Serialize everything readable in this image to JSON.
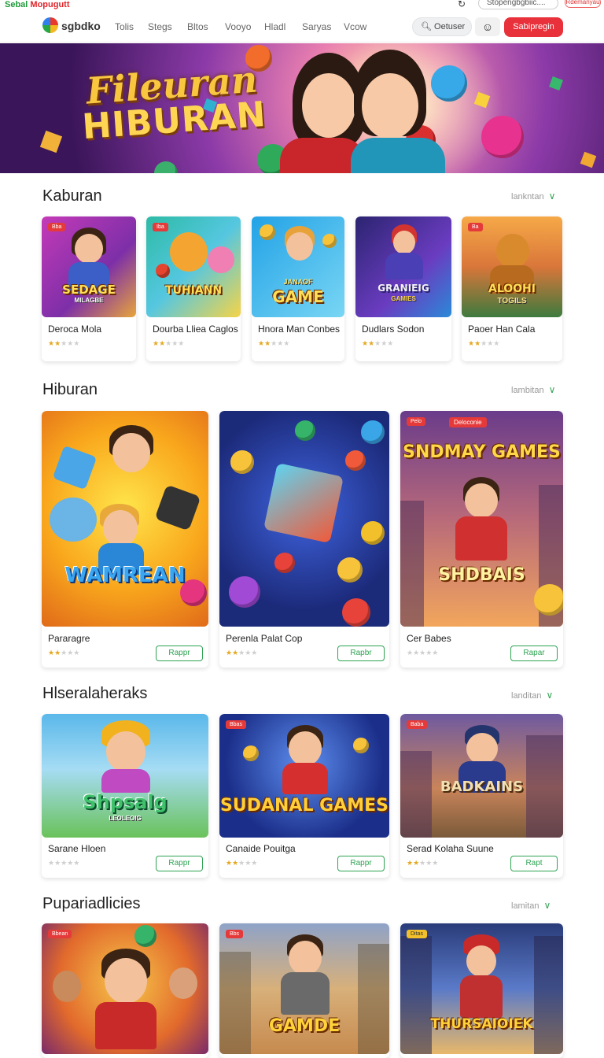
{
  "topstrip": {
    "brand_green": "Sebal",
    "brand_red": "Mopugutt",
    "search_text": "Stopengbgbiic....",
    "pill_text": "Rdemanyau"
  },
  "nav": {
    "logo_text": "sgbdko",
    "links": [
      "Tolis",
      "Stegs",
      "Bltos",
      "Vooyo",
      "Hladl",
      "Saryas",
      "Vcow"
    ],
    "search_placeholder": "Oetuser",
    "cta_label": "Sabipregin"
  },
  "hero": {
    "title_line1": "Fileuran",
    "title_line2": "HIBURAN"
  },
  "sections": [
    {
      "title": "Kaburan",
      "more": "lankntan",
      "cards": [
        {
          "name": "Deroca Mola",
          "rating": 2,
          "badge": "Bba",
          "art_title": "SEDAGE",
          "art_sub": "MILAGBE",
          "colors": [
            "#b13ac0",
            "#e7a73b"
          ]
        },
        {
          "name": "Dourba Lliea Caglos",
          "rating": 2,
          "badge": "Iba",
          "art_title": "TUHIANN",
          "art_sub": "",
          "colors": [
            "#3dbfa4",
            "#f3d34a"
          ]
        },
        {
          "name": "Hnora Man Conbes",
          "rating": 2,
          "badge": "",
          "art_title": "GAME",
          "art_sub": "JANAOF",
          "colors": [
            "#2ea6e8",
            "#7fd6f5"
          ]
        },
        {
          "name": "Dudlars Sodon",
          "rating": 2,
          "badge": "",
          "art_title": "GRANIEIG",
          "art_sub": "GAMIES",
          "colors": [
            "#3a2a8c",
            "#8c4ad2"
          ]
        },
        {
          "name": "Paoer Han Cala",
          "rating": 2,
          "badge": "Ba",
          "art_title": "ALOOHI",
          "art_sub": "TOGILS",
          "colors": [
            "#f09a3a",
            "#4b8a4a"
          ]
        }
      ]
    },
    {
      "title": "Hiburan",
      "more": "lambitan",
      "cards": [
        {
          "name": "Pararagre",
          "rating": 2,
          "play": "Rappr",
          "badge": "",
          "art_title": "WAMREAN",
          "art_sub": "",
          "colors": [
            "#f7a71e",
            "#ffdf4d"
          ]
        },
        {
          "name": "Perenla Palat Cop",
          "rating": 2,
          "play": "Rapbr",
          "badge": "",
          "art_title": "",
          "art_sub": "",
          "colors": [
            "#1d2a7c",
            "#3f5ad6"
          ]
        },
        {
          "name": "Cer Babes",
          "rating": 0,
          "play": "Rapar",
          "badge": "Pelo",
          "badge2": "Deloconie",
          "art_title": "SNDMAY GAMES",
          "art_sub": "SHDBAIS",
          "colors": [
            "#7a3c8a",
            "#f4b062"
          ]
        }
      ]
    },
    {
      "title": "Hlseralaheraks",
      "more": "landitan",
      "cards": [
        {
          "name": "Sarane Hloen",
          "rating": 0,
          "play": "Rappr",
          "badge": "",
          "art_title": "Shpsalg",
          "art_sub": "LEOLEOIG",
          "colors": [
            "#3aa0e0",
            "#8fd36a"
          ]
        },
        {
          "name": "Canaide Pouitga",
          "rating": 2,
          "play": "Rappr",
          "badge": "Bbas",
          "art_title": "SUDANAL GAMES",
          "art_sub": "",
          "colors": [
            "#1e3b9c",
            "#4778e6"
          ]
        },
        {
          "name": "Serad Kolaha Suune",
          "rating": 2,
          "play": "Rapt",
          "badge": "Baba",
          "art_title": "BADKAINS",
          "art_sub": "",
          "colors": [
            "#5a3f7e",
            "#e8a35a"
          ]
        }
      ]
    },
    {
      "title": "Pupariadlicies",
      "more": "lamitan",
      "cards": [
        {
          "name": "",
          "badge": "Bbean",
          "art_title": "",
          "colors": [
            "#e26a2c",
            "#f5c04a"
          ]
        },
        {
          "name": "",
          "badge": "Bbs",
          "art_title": "GAMDE",
          "colors": [
            "#c68a4e",
            "#f2cf8a"
          ]
        },
        {
          "name": "",
          "badge": "Ditas",
          "art_title": "THURSAIOIEK",
          "colors": [
            "#2a3c7a",
            "#7ca3e0"
          ]
        }
      ]
    }
  ]
}
